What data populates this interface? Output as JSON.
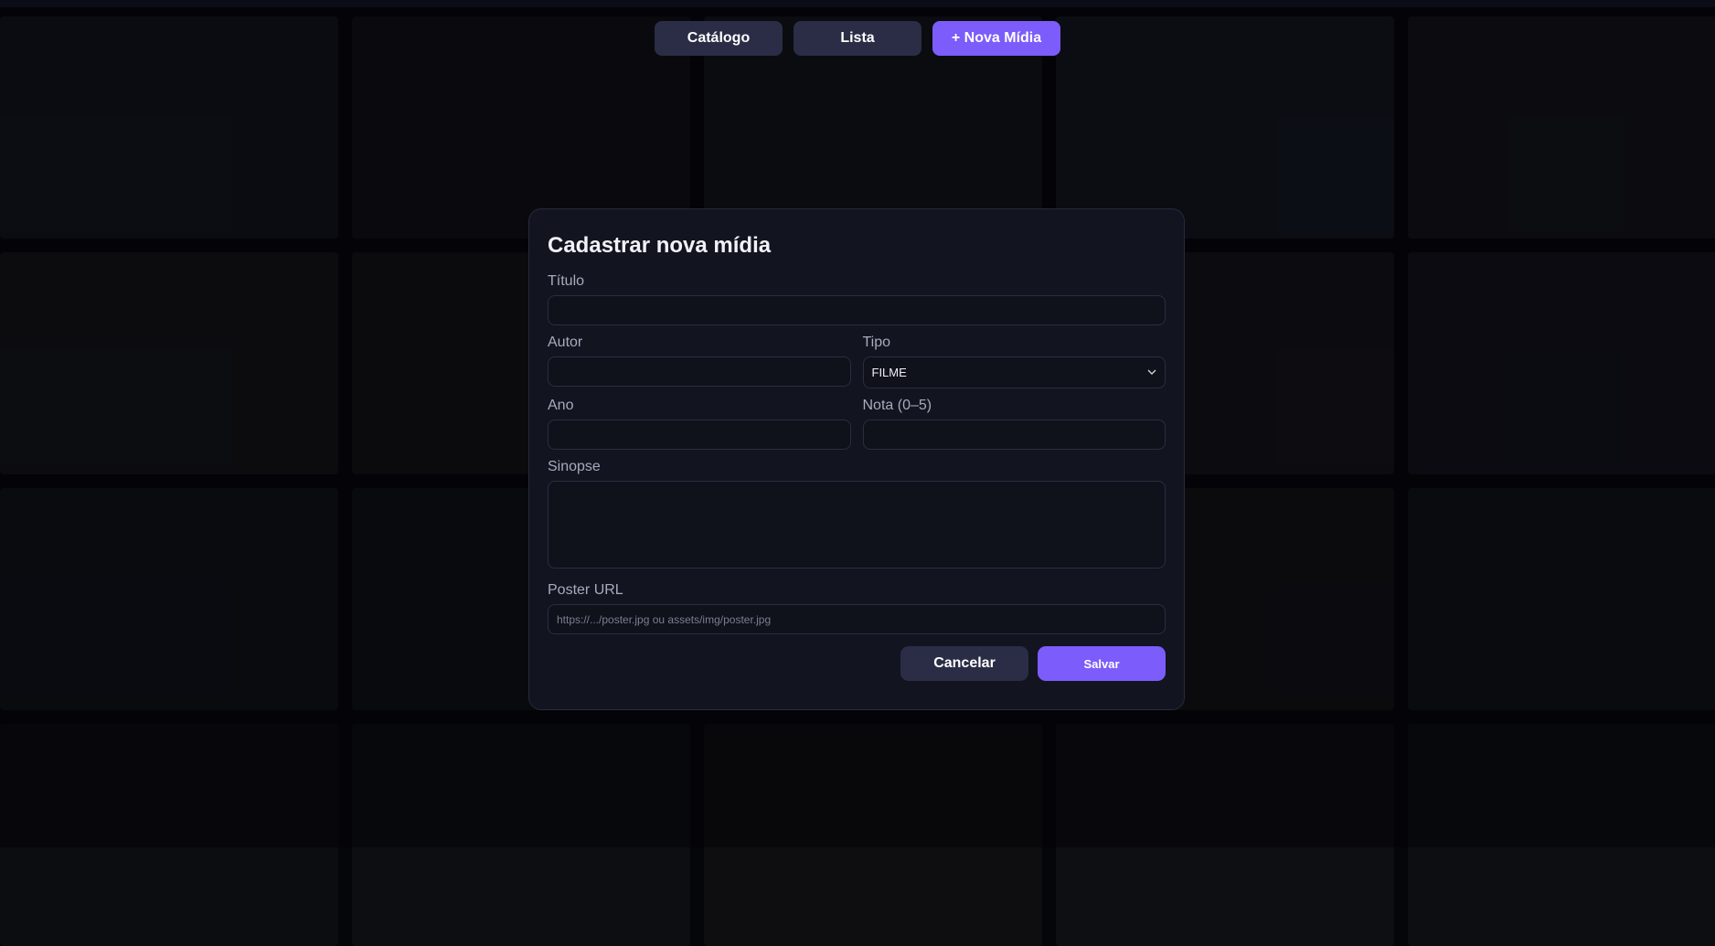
{
  "nav": {
    "catalog_label": "Catálogo",
    "list_label": "Lista",
    "new_media_label": "+ Nova Mídia"
  },
  "modal": {
    "title": "Cadastrar nova mídia",
    "fields": {
      "title_label": "Título",
      "title_value": "",
      "author_label": "Autor",
      "author_value": "",
      "type_label": "Tipo",
      "type_value": "FILME",
      "year_label": "Ano",
      "year_value": "",
      "rating_label": "Nota (0–5)",
      "rating_value": "",
      "synopsis_label": "Sinopse",
      "synopsis_value": "",
      "poster_label": "Poster URL",
      "poster_placeholder": "https://.../poster.jpg ou assets/img/poster.jpg"
    },
    "cancel_label": "Cancelar",
    "save_label": "Salvar"
  },
  "colors": {
    "accent": "#7c5cfa",
    "button_secondary": "#2a2d45",
    "modal_bg": "#121420",
    "page_bg": "#05060a"
  },
  "icons": {
    "select_chevron": "chevron-down-icon"
  }
}
